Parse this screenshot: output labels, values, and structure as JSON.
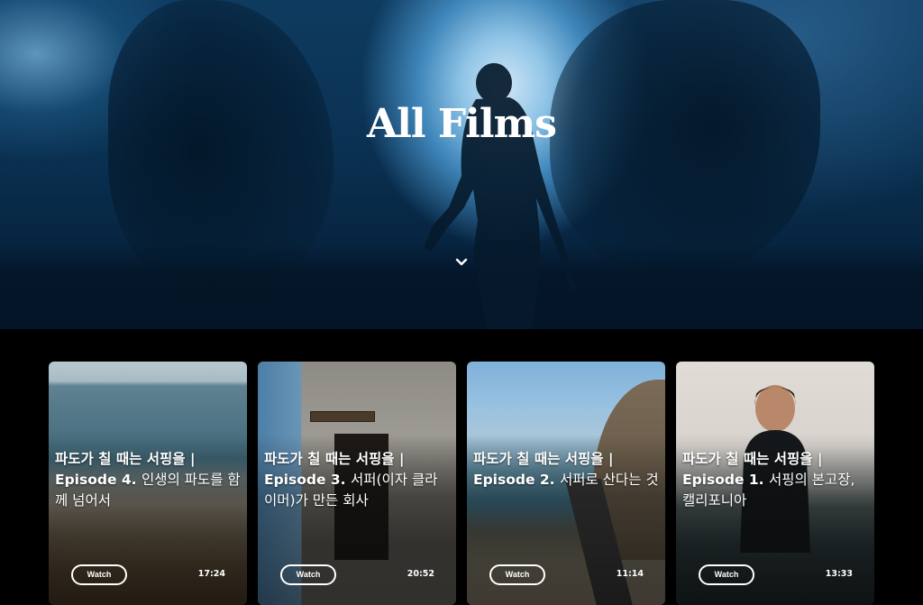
{
  "hero": {
    "title": "All Films",
    "scroll_icon": "chevron-down-icon"
  },
  "films": [
    {
      "series": "파도가 칠 때는 서핑을 |",
      "episode": "Episode 4.",
      "subtitle": "인생의 파도를 함께 넘어서",
      "watch_label": "Watch",
      "duration": "17:24"
    },
    {
      "series": "파도가 칠 때는 서핑을 |",
      "episode": "Episode 3.",
      "subtitle": "서퍼(이자 클라이머)가 만든 회사",
      "watch_label": "Watch",
      "duration": "20:52"
    },
    {
      "series": "파도가 칠 때는 서핑을 |",
      "episode": "Episode 2.",
      "subtitle": "서퍼로 산다는 것",
      "watch_label": "Watch",
      "duration": "11:14"
    },
    {
      "series": "파도가 칠 때는 서핑을 |",
      "episode": "Episode 1.",
      "subtitle": "서핑의 본고장, 캘리포니아",
      "watch_label": "Watch",
      "duration": "13:33"
    }
  ]
}
